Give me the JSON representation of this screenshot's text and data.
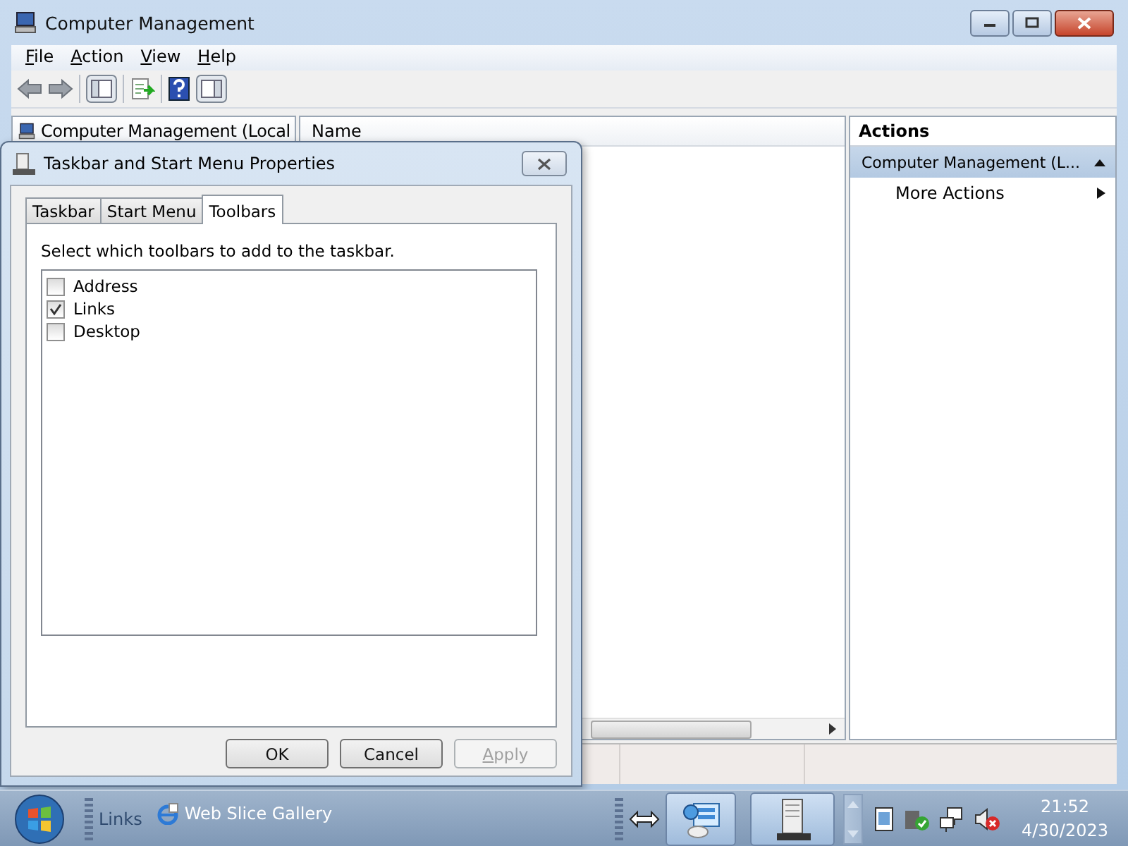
{
  "main_window": {
    "title": "Computer Management",
    "menu": [
      "File",
      "Action",
      "View",
      "Help"
    ],
    "tree_header": "Computer Management (Local",
    "list_header": "Name",
    "actions": {
      "title": "Actions",
      "group": "Computer Management (L...",
      "expanded": true,
      "items": [
        "More Actions"
      ]
    }
  },
  "dialog": {
    "title": "Taskbar and Start Menu Properties",
    "tabs": [
      {
        "label": "Taskbar",
        "selected": false
      },
      {
        "label": "Start Menu",
        "selected": false
      },
      {
        "label": "Toolbars",
        "selected": true
      }
    ],
    "instruction": "Select which toolbars to add to the taskbar.",
    "toolbars": [
      {
        "label": "Address",
        "checked": false
      },
      {
        "label": "Links",
        "checked": true
      },
      {
        "label": "Desktop",
        "checked": false
      }
    ],
    "buttons": [
      {
        "label": "OK",
        "disabled": false
      },
      {
        "label": "Cancel",
        "disabled": false
      },
      {
        "label": "Apply",
        "disabled": true
      }
    ]
  },
  "taskbar": {
    "toolbar_label": "Links",
    "link": "Web Slice Gallery",
    "time": "21:52",
    "date": "4/30/2023"
  }
}
